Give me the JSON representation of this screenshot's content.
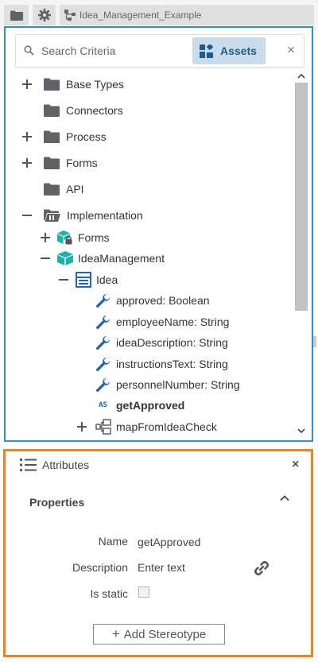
{
  "top_tabs": [
    {
      "icon": "folder-icon"
    },
    {
      "icon": "gear-icon"
    },
    {
      "icon": "diagram-icon",
      "label": "Idea_Management_Example"
    }
  ],
  "tree_panel": {
    "search": {
      "placeholder": "Search Criteria",
      "value": ""
    },
    "assets_button": "Assets",
    "clear_button": "×",
    "border_color": "#2f8fd0",
    "rows": [
      {
        "label": "Base Types",
        "expander": "+",
        "icon": "folder-icon"
      },
      {
        "label": "Connectors",
        "expander": "",
        "icon": "folder-icon"
      },
      {
        "label": "Process",
        "expander": "+",
        "icon": "folder-icon"
      },
      {
        "label": "Forms",
        "expander": "+",
        "icon": "folder-icon"
      },
      {
        "label": "API",
        "expander": "",
        "icon": "folder-icon"
      },
      {
        "label": "Implementation",
        "expander": "−",
        "icon": "folder-open-icon"
      },
      {
        "label": "Forms",
        "expander": "+",
        "icon": "locked-package-icon"
      },
      {
        "label": "IdeaManagement",
        "expander": "−",
        "icon": "package-icon"
      },
      {
        "label": "Idea",
        "expander": "−",
        "icon": "class-icon"
      },
      {
        "label": "approved: Boolean",
        "icon": "wrench-icon"
      },
      {
        "label": "employeeName: String",
        "icon": "wrench-icon"
      },
      {
        "label": "ideaDescription: String",
        "icon": "wrench-icon"
      },
      {
        "label": "instructionsText: String",
        "icon": "wrench-icon"
      },
      {
        "label": "personnelNumber: String",
        "icon": "wrench-icon"
      },
      {
        "label": "getApproved",
        "icon": "as-script-icon",
        "icon_text": "AS",
        "bold": true
      },
      {
        "label": "mapFromIdeaCheck",
        "expander": "+",
        "icon": "mapping-icon"
      }
    ]
  },
  "attributes_panel": {
    "title": "Attributes",
    "close": "×",
    "border_color": "#f08223",
    "section_title": "Properties",
    "fields": {
      "name_label": "Name",
      "name_value": "getApproved",
      "description_label": "Description",
      "description_placeholder": "Enter text",
      "is_static_label": "Is static",
      "is_static_checked": false
    },
    "add_stereotype": "Add Stereotype",
    "add_stereotype_plus": "+"
  },
  "colors": {
    "accent_blue": "#1e5a8a",
    "icon_grey": "#5f6368",
    "icon_blue": "#1e66b5",
    "icon_teal": "#1fb6a9"
  }
}
